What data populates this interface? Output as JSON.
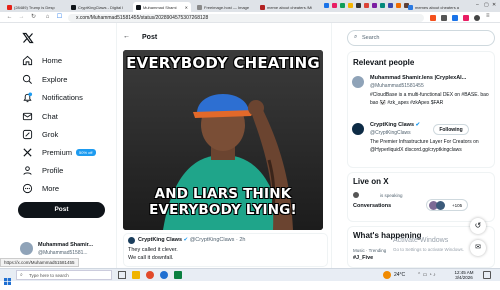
{
  "browser": {
    "tabs": [
      {
        "label": "(28489) Trump is Desp",
        "color": "#e62117"
      },
      {
        "label": "CryptKingClaws - Digital I",
        "color": "#0f1419"
      },
      {
        "label": "Muhammad Shami",
        "color": "#0f1419"
      },
      {
        "label": "Freeimage.host — Image",
        "color": "#8a8a8a"
      },
      {
        "label": "meme about cheaters /Mi",
        "color": "#b22222"
      },
      {
        "label": "memes about cheaters a",
        "color": "#2a7ae2"
      }
    ],
    "url": "x.com/Muhammad51581455/status/2028904575307268128",
    "fav_colors": [
      "#1a73e8",
      "#e91e63",
      "#0f9d58",
      "#f4b400",
      "#333333",
      "#db4437",
      "#7b1fa2",
      "#00897b",
      "#3949ab",
      "#ef6c00",
      "#5d4037",
      "#43a047",
      "#1e88e5",
      "#c2185b"
    ]
  },
  "nav": {
    "items": [
      {
        "label": "Home",
        "icon": "home-icon"
      },
      {
        "label": "Explore",
        "icon": "search-icon"
      },
      {
        "label": "Notifications",
        "icon": "bell-icon"
      },
      {
        "label": "Chat",
        "icon": "mail-icon"
      },
      {
        "label": "Grok",
        "icon": "grok-icon"
      },
      {
        "label": "Premium",
        "icon": "x-premium-icon",
        "badge": "50% off"
      },
      {
        "label": "Profile",
        "icon": "person-icon"
      },
      {
        "label": "More",
        "icon": "more-circle-icon"
      }
    ],
    "post_button": "Post",
    "account": {
      "name": "Muhammad Shamir...",
      "handle": "@Muhammad51581..."
    }
  },
  "main": {
    "header_title": "Post",
    "meme": {
      "top_text": "EVERYBODY CHEATING",
      "bottom_text": "AND LIARS THINK EVERYBODY LYING!"
    },
    "quote": {
      "name": "CryptKing Claws",
      "handle": "@CryptKingClaws",
      "age": "2h",
      "line1": "They called it clever.",
      "line2": "We call it downfall."
    }
  },
  "right": {
    "search_placeholder": "Search",
    "relevant": {
      "title": "Relevant people",
      "people": [
        {
          "name": "Muhammad Shamir.lens |CryplexAI...",
          "handle": "@Muhammad51581455",
          "bio": "#CloudBase is a multi-functional DEX on #BASE. bao bao 🐼 #zk_apes #zkApes $FAR"
        },
        {
          "name": "CryptKing Claws",
          "handle": "@CryptKingClaws",
          "follow": "Following",
          "bio": "The Premier Infrastructure Layer For Creators on @HyperliquidX discord.gg/cryptkingclaws"
        }
      ]
    },
    "live": {
      "title": "Live on X",
      "speaker": "is speaking",
      "conversations": "Conversations",
      "count": "+105"
    },
    "happening": {
      "title": "What's happening",
      "subtitle": "Music · Trending",
      "trend": "#J_Five"
    },
    "watermark": {
      "line1": "Activate Windows",
      "line2": "Go to Settings to activate Windows."
    }
  },
  "status_url": "https://x.com/Muhammad51581455",
  "taskbar": {
    "search_placeholder": "Type here to search",
    "weather": "24°C",
    "time": "12:45 AM",
    "date": "3/4/2026"
  },
  "colors": {
    "accent": "#1d9bf0",
    "dark": "#0f1419"
  }
}
